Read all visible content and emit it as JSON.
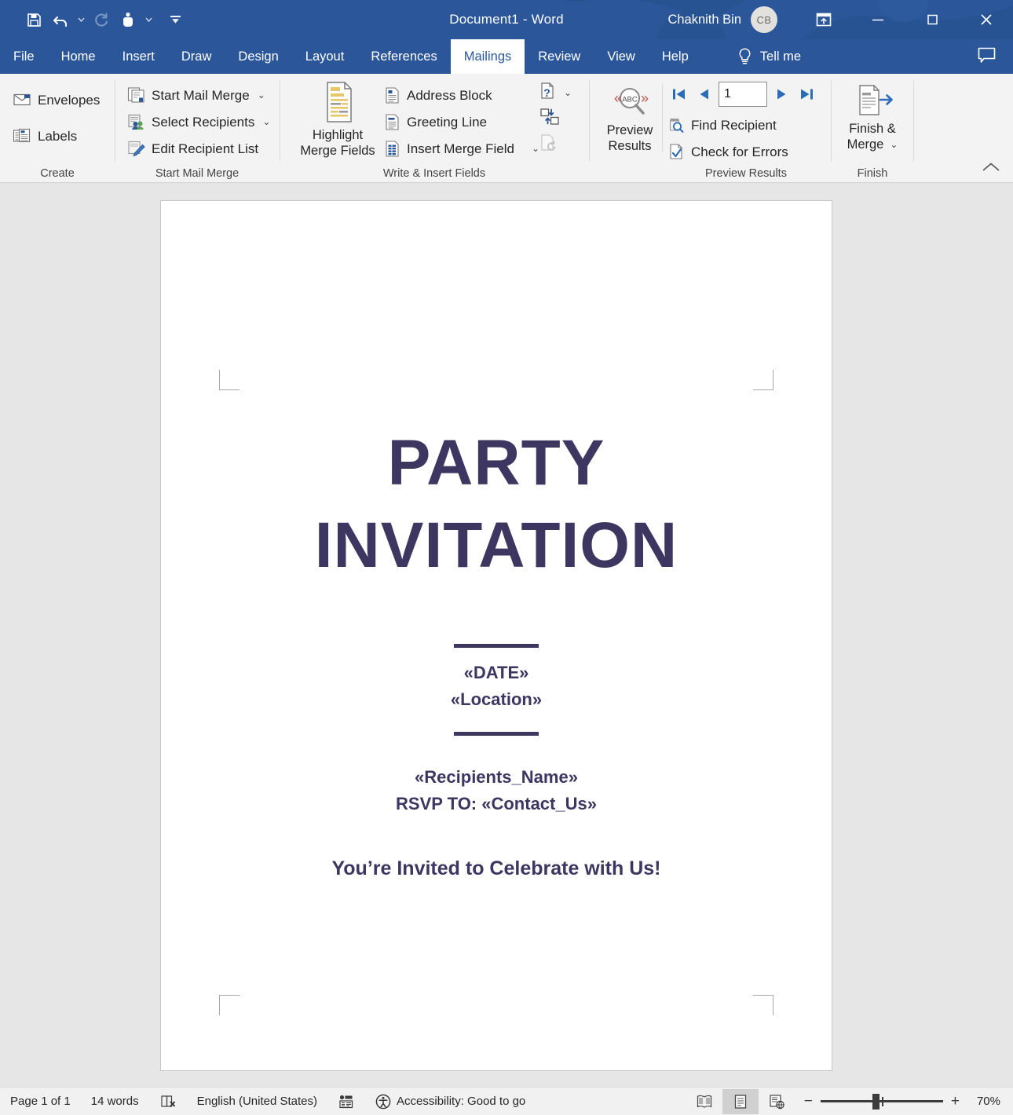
{
  "titlebar": {
    "quick_access": [
      {
        "name": "save-button",
        "icon": "save-icon"
      },
      {
        "name": "undo-button",
        "icon": "undo-icon",
        "has_caret": true
      },
      {
        "name": "redo-button",
        "icon": "redo-icon",
        "disabled": true
      },
      {
        "name": "touch-mouse-mode-button",
        "icon": "touch-mode-icon",
        "has_caret": true
      },
      {
        "name": "customize-quick-access-toolbar-button",
        "icon": "customize-qat-icon"
      }
    ],
    "document_title": "Document1  -  Word",
    "account_name": "Chaknith Bin",
    "account_initials": "CB",
    "ribbon_display_options_label": "Ribbon Display Options",
    "minimize_label": "Minimize",
    "restore_label": "Restore Down",
    "close_label": "Close",
    "accent_color": "#2b579a"
  },
  "tabs": [
    {
      "label": "File",
      "active": false
    },
    {
      "label": "Home",
      "active": false
    },
    {
      "label": "Insert",
      "active": false
    },
    {
      "label": "Draw",
      "active": false
    },
    {
      "label": "Design",
      "active": false
    },
    {
      "label": "Layout",
      "active": false
    },
    {
      "label": "References",
      "active": false
    },
    {
      "label": "Mailings",
      "active": true
    },
    {
      "label": "Review",
      "active": false
    },
    {
      "label": "View",
      "active": false
    },
    {
      "label": "Help",
      "active": false
    }
  ],
  "tellme": {
    "label": "Tell me"
  },
  "comments": {
    "label": "Comments"
  },
  "ribbon": {
    "collapse_label": "Collapse the Ribbon",
    "groups": [
      {
        "name": "create",
        "label": "Create",
        "items": [
          {
            "label": "Envelopes",
            "icon": "envelope-icon"
          },
          {
            "label": "Labels",
            "icon": "labels-icon"
          }
        ]
      },
      {
        "name": "start-mail-merge",
        "label": "Start Mail Merge",
        "items": [
          {
            "label": "Start Mail Merge",
            "icon": "start-mail-merge-icon",
            "has_caret": true
          },
          {
            "label": "Select Recipients",
            "icon": "select-recipients-icon",
            "has_caret": true
          },
          {
            "label": "Edit Recipient List",
            "icon": "edit-recipient-list-icon",
            "has_caret": false
          }
        ]
      },
      {
        "name": "write-and-insert-fields",
        "label": "Write & Insert Fields",
        "big_button": {
          "label_line1": "Highlight",
          "label_line2": "Merge Fields",
          "icon": "highlight-merge-fields-icon"
        },
        "items": [
          {
            "label": "Address Block",
            "icon": "address-block-icon"
          },
          {
            "label": "Greeting Line",
            "icon": "greeting-line-icon"
          },
          {
            "label": "Insert Merge Field",
            "icon": "insert-merge-field-icon",
            "has_caret": true
          }
        ],
        "icon_only": [
          {
            "name": "rules",
            "icon": "rules-icon",
            "has_caret": true,
            "disabled": false
          },
          {
            "name": "match-fields",
            "icon": "match-fields-icon",
            "disabled": false
          },
          {
            "name": "update-labels",
            "icon": "update-labels-icon",
            "disabled": true
          }
        ]
      },
      {
        "name": "preview-results",
        "label": "Preview Results",
        "big_button": {
          "label_line1": "Preview",
          "label_line2": "Results",
          "icon": "preview-results-icon"
        },
        "record_nav": {
          "first_label": "First Record",
          "previous_label": "Previous Record",
          "record_number": "1",
          "next_label": "Next Record",
          "last_label": "Last Record"
        },
        "items": [
          {
            "label": "Find Recipient",
            "icon": "find-recipient-icon"
          },
          {
            "label": "Check for Errors",
            "icon": "check-for-errors-icon"
          }
        ]
      },
      {
        "name": "finish",
        "label": "Finish",
        "big_button": {
          "label_line1": "Finish &",
          "label_line2": "Merge",
          "icon": "finish-and-merge-icon",
          "has_caret": true
        }
      }
    ]
  },
  "document": {
    "title_line1": "PARTY",
    "title_line2": "INVITATION",
    "date_field": "«DATE»",
    "location_field": "«Location»",
    "recipient_field": "«Recipients_Name»",
    "rsvp_line": "RSVP TO: «Contact_Us»",
    "tagline": "You’re Invited to Celebrate with Us!",
    "text_color": "#3d3661"
  },
  "statusbar": {
    "page_info": "Page 1 of 1",
    "word_count": "14 words",
    "proofing_icon": "proofing-errors-icon",
    "language": "English (United States)",
    "track_changes_icon": "track-changes-icon",
    "accessibility": "Accessibility: Good to go",
    "views": [
      {
        "name": "read-mode",
        "label": "Read Mode",
        "selected": false
      },
      {
        "name": "print-layout",
        "label": "Print Layout",
        "selected": true
      },
      {
        "name": "web-layout",
        "label": "Web Layout",
        "selected": false
      }
    ],
    "zoom_out_label": "Zoom Out",
    "zoom_in_label": "Zoom In",
    "zoom_level": "70%"
  }
}
